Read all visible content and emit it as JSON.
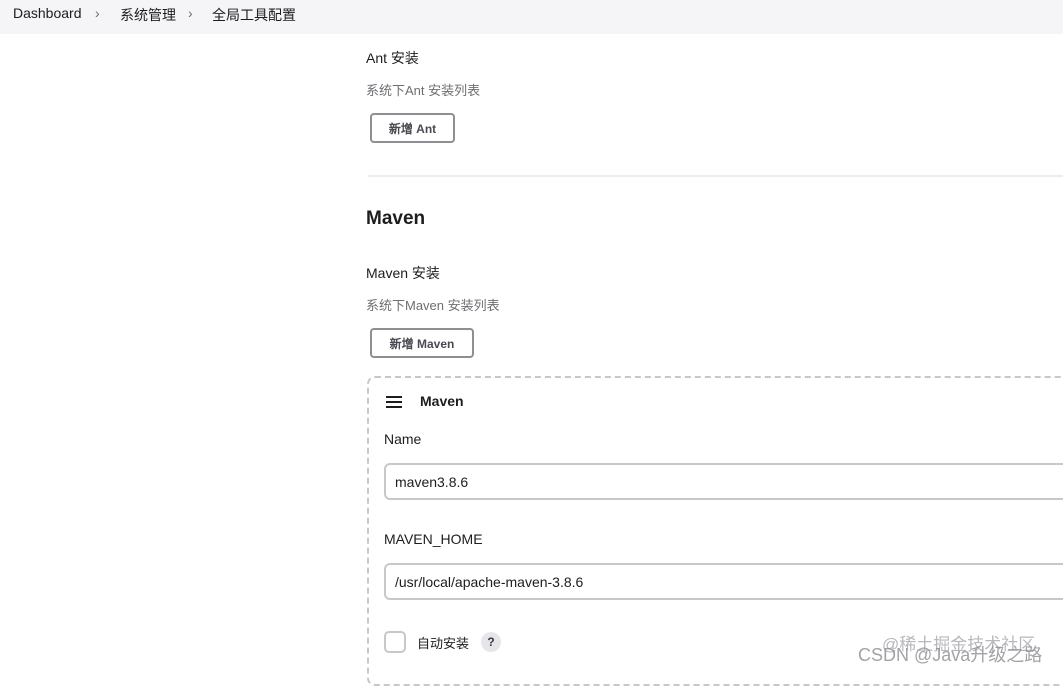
{
  "breadcrumb": {
    "items": [
      "Dashboard",
      "系统管理",
      "全局工具配置"
    ],
    "separator": ">"
  },
  "ant": {
    "label": "Ant 安装",
    "description": "系统下Ant 安装列表",
    "add_button": "新增 Ant"
  },
  "maven": {
    "section_title": "Maven",
    "label": "Maven 安装",
    "description": "系统下Maven 安装列表",
    "add_button": "新增 Maven",
    "card": {
      "title": "Maven",
      "name_label": "Name",
      "name_value": "maven3.8.6",
      "home_label": "MAVEN_HOME",
      "home_value": "/usr/local/apache-maven-3.8.6",
      "auto_install_label": "自动安装",
      "help_symbol": "?"
    }
  },
  "watermark": {
    "line1": "@稀土掘金技术社区",
    "line2": "CSDN @Java升级之路"
  },
  "colors": {
    "breadcrumb_bg": "#f5f5f7",
    "button_border": "#8e8e93",
    "muted_text": "#6e6e73"
  }
}
